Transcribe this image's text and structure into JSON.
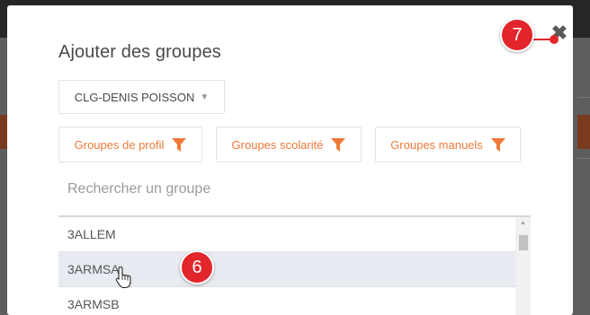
{
  "modal": {
    "title": "Ajouter des groupes",
    "close_icon": "close-icon"
  },
  "school_select": {
    "value": "CLG-DENIS POISSON",
    "icon": "caret-down-icon"
  },
  "filters": [
    {
      "label": "Groupes de profil",
      "icon": "funnel-icon"
    },
    {
      "label": "Groupes scolarité",
      "icon": "funnel-icon"
    },
    {
      "label": "Groupes manuels",
      "icon": "funnel-icon"
    }
  ],
  "search": {
    "placeholder": "Rechercher un groupe",
    "value": ""
  },
  "groups": [
    "3ALLEM",
    "3ARMSA",
    "3ARMSB"
  ],
  "selected_group": "3ARMSA",
  "annotations": {
    "step_6": "6",
    "step_7": "7"
  },
  "colors": {
    "accent": "#ef7a39",
    "step_badge": "#e2252b",
    "selected_row": "#e8ebf1"
  }
}
